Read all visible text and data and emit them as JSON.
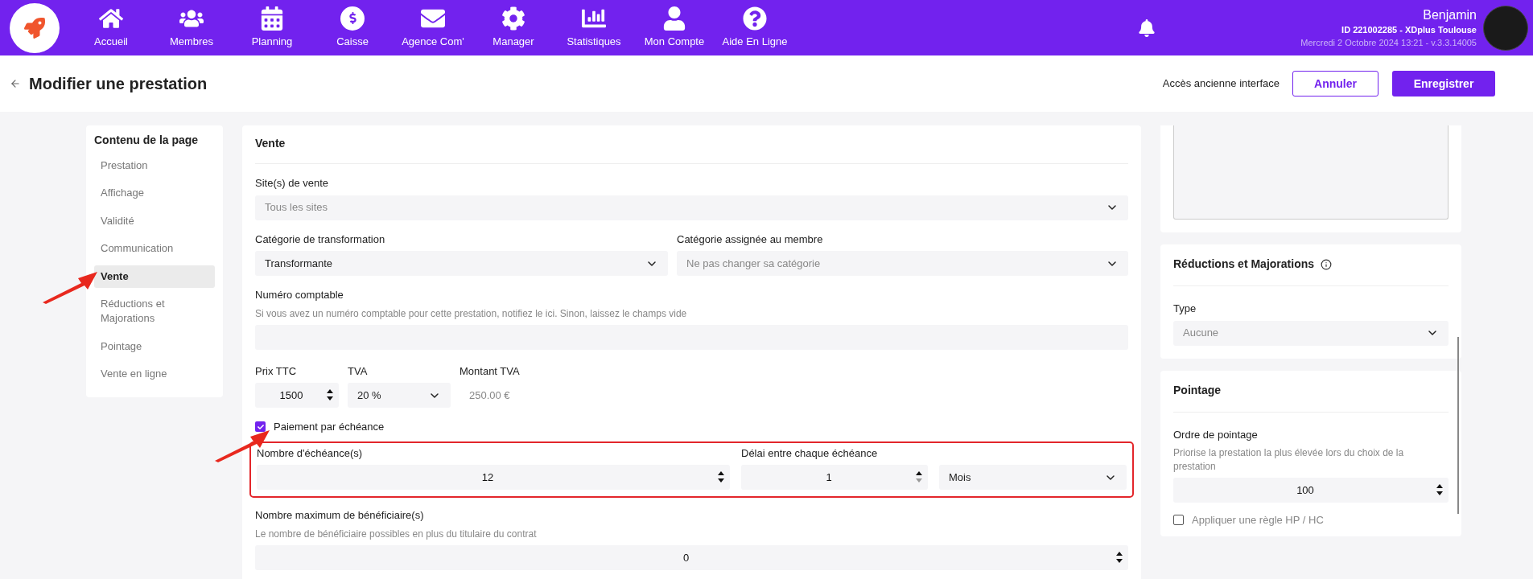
{
  "topbar": {
    "nav": [
      {
        "label": "Accueil"
      },
      {
        "label": "Membres"
      },
      {
        "label": "Planning"
      },
      {
        "label": "Caisse"
      },
      {
        "label": "Agence Com'"
      },
      {
        "label": "Manager"
      },
      {
        "label": "Statistiques"
      },
      {
        "label": "Mon Compte"
      },
      {
        "label": "Aide En Ligne"
      }
    ],
    "user": {
      "name": "Benjamin",
      "id": "ID 221002285 - XDplus Toulouse",
      "info": "Mercredi 2 Octobre 2024 13:21 - v.3.3.14005"
    }
  },
  "header": {
    "title": "Modifier une prestation",
    "link": "Accès ancienne interface",
    "buttons": [
      {
        "label": "Annuler",
        "kind": "outline"
      },
      {
        "label": "Enregistrer",
        "kind": "primary"
      }
    ]
  },
  "sidebar": {
    "title": "Contenu de la page",
    "items": [
      {
        "label": "Prestation",
        "selected": false,
        "annotated": false
      },
      {
        "label": "Affichage",
        "selected": false,
        "annotated": false
      },
      {
        "label": "Validité",
        "selected": false,
        "annotated": false
      },
      {
        "label": "Communication",
        "selected": false,
        "annotated": false
      },
      {
        "label": "Vente",
        "selected": true,
        "annotated": true
      },
      {
        "label": "Réductions et Majorations",
        "selected": false,
        "annotated": false
      },
      {
        "label": "Pointage",
        "selected": false,
        "annotated": false
      },
      {
        "label": "Vente en ligne",
        "selected": false,
        "annotated": false
      }
    ]
  },
  "sale": {
    "title": "Vente",
    "sites": {
      "label": "Site(s) de vente",
      "placeholder": "Tous les sites"
    },
    "category": {
      "label": "Catégorie de transformation",
      "value": "Transformante"
    },
    "member_category": {
      "label": "Catégorie assignée au membre",
      "placeholder": "Ne pas changer sa catégorie"
    },
    "account": {
      "label": "Numéro comptable",
      "help": "Si vous avez un numéro comptable pour cette prestation, notifiez le ici. Sinon, laissez le champs vide"
    },
    "price": {
      "label": "Prix TTC",
      "value": "1500"
    },
    "vat": {
      "label": "TVA",
      "value": "20 %"
    },
    "vat_amount": {
      "label": "Montant TVA",
      "value": "250.00 €"
    },
    "installments": {
      "label": "Paiement par échéance",
      "checked": true,
      "annotated": true
    },
    "schedule": {
      "highlighted": true,
      "count": {
        "label": "Nombre d'échéance(s)",
        "value": "12"
      },
      "delay": {
        "label": "Délai entre chaque échéance",
        "value": "1"
      },
      "unit": {
        "value": "Mois"
      }
    },
    "beneficiaries": {
      "label": "Nombre maximum de bénéficiaire(s)",
      "help": "Le nombre de bénéficiaire possibles en plus du titulaire du contrat",
      "value": "0"
    }
  },
  "right": {
    "reductions": {
      "title": "Réductions et Majorations",
      "type": {
        "label": "Type",
        "placeholder": "Aucune"
      }
    },
    "pointage": {
      "title": "Pointage",
      "order": {
        "label": "Ordre de pointage",
        "help": "Priorise la prestation la plus élevée lors du choix de la prestation",
        "value": "100"
      },
      "hp_hc": {
        "label": "Appliquer une règle HP / HC",
        "checked": false
      }
    }
  }
}
